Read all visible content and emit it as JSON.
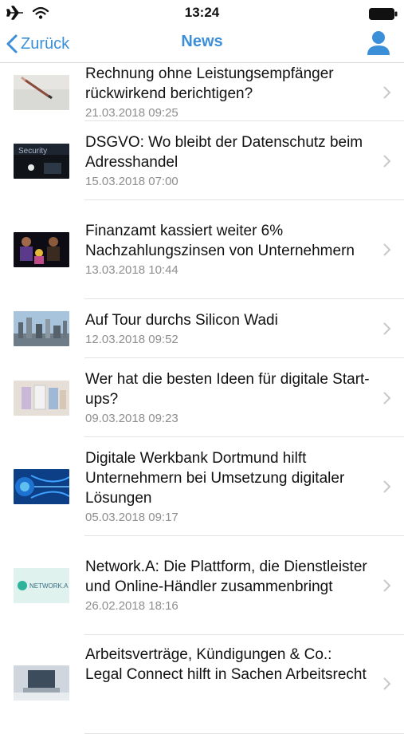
{
  "status_bar": {
    "time": "13:24",
    "icons": [
      "airplane-icon",
      "wifi-icon",
      "battery-icon"
    ]
  },
  "nav": {
    "back_label": "Zurück",
    "title": "News",
    "right_icon": "profile-icon",
    "accent_color": "#3a8fd8"
  },
  "news": [
    {
      "title": "Rechnung ohne Leistungsempfänger rückwirkend berichtigen?",
      "date": "21.03.2018 09:25",
      "thumb": "pencil-paper"
    },
    {
      "title": "DSGVO: Wo bleibt der Datenschutz beim Adresshandel",
      "date": "15.03.2018 07:00",
      "thumb": "security-dark"
    },
    {
      "title": "Finanzamt kassiert weiter 6% Nachzahlungszinsen von Unternehmern",
      "date": "13.03.2018 10:44",
      "thumb": "people-dark"
    },
    {
      "title": "Auf Tour durchs Silicon Wadi",
      "date": "12.03.2018 09:52",
      "thumb": "city-skyline"
    },
    {
      "title": "Wer hat die besten Ideen für digitale Start-ups?",
      "date": "09.03.2018 09:23",
      "thumb": "booklets"
    },
    {
      "title": "Digitale Werkbank Dortmund hilft Unternehmern bei Umsetzung digitaler Lösungen",
      "date": "05.03.2018 09:17",
      "thumb": "digital-blue"
    },
    {
      "title": "Network.A: Die Plattform, die Dienstleister und Online-Händler zusammenbringt",
      "date": "26.02.2018 18:16",
      "thumb": "network-logo"
    },
    {
      "title": "Arbeitsverträge, Kündigungen & Co.: Legal Connect hilft in Sachen Arbeitsrecht",
      "date": "",
      "thumb": "laptop"
    }
  ],
  "thumb_texts": {
    "security": "Security",
    "network": "NETWORK.A"
  }
}
